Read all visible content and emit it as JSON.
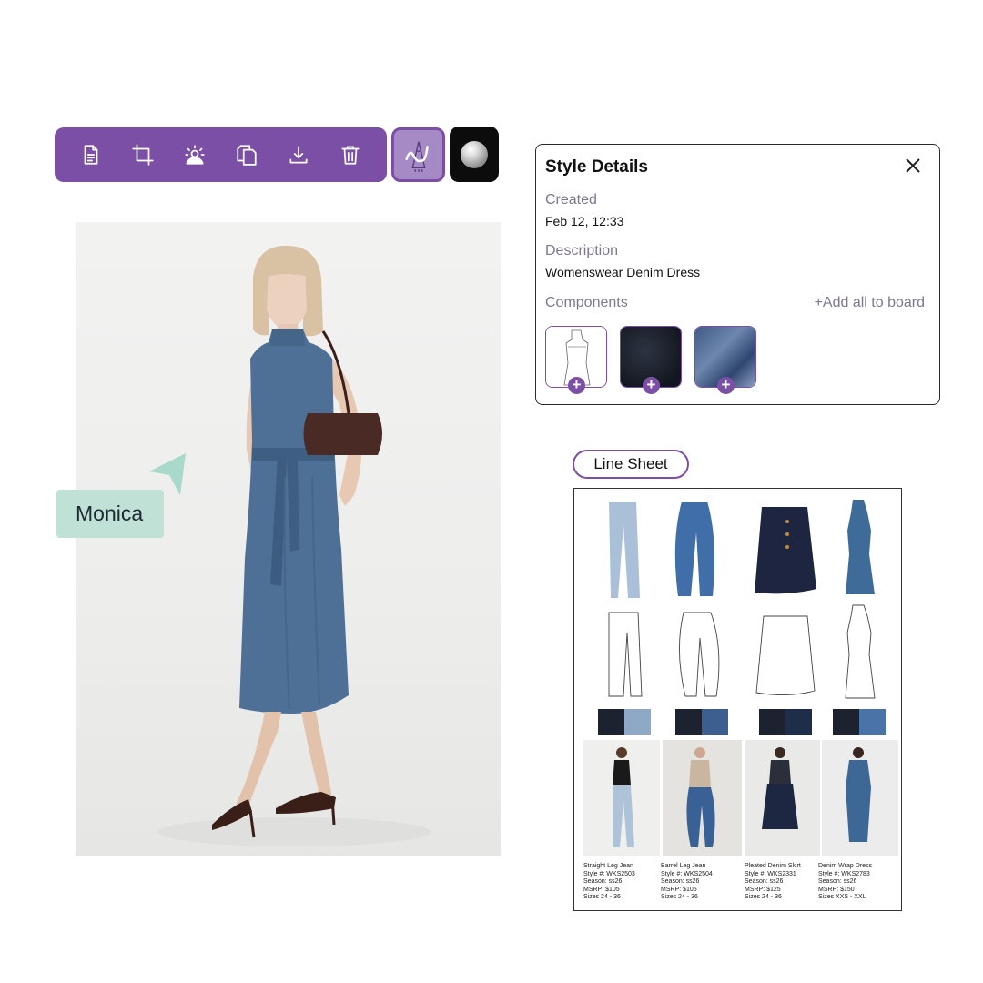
{
  "toolbar": {
    "tools": [
      "document-icon",
      "crop-icon",
      "relight-icon",
      "duplicate-icon",
      "download-icon",
      "trash-icon"
    ],
    "draw_tool": "pen-icon",
    "color_swatch": "#c0c0c0",
    "accent": "#7b4fa5"
  },
  "collaborator": {
    "name": "Monica",
    "color": "#bfe1d6"
  },
  "details": {
    "title": "Style Details",
    "created_label": "Created",
    "created_value": "Feb 12, 12:33",
    "description_label": "Description",
    "description_value": "Womenswear Denim Dress",
    "components_label": "Components",
    "add_all": "+Add all to board",
    "components": [
      "flat-sketch",
      "dark-denim-swatch",
      "light-denim-swatch"
    ]
  },
  "line_sheet": {
    "tab_label": "Line Sheet",
    "items": [
      {
        "name": "Straight Leg Jean",
        "style": "Style #: WKS2503",
        "season": "Season: ss26",
        "msrp": "MSRP: $105",
        "sizes": "Sizes 24 - 36"
      },
      {
        "name": "Barrel Leg Jean",
        "style": "Style #: WKS2504",
        "season": "Season: ss26",
        "msrp": "MSRP: $105",
        "sizes": "Sizes 24 - 36"
      },
      {
        "name": "Pleated Denim Skirt",
        "style": "Style #: WKS2331",
        "season": "Season: ss26",
        "msrp": "MSRP: $125",
        "sizes": "Sizes 24 - 36"
      },
      {
        "name": "Denim Wrap Dress",
        "style": "Style #: WKS2783",
        "season": "Season: ss26",
        "msrp": "MSRP: $150",
        "sizes": "Sizes XXS - XXL"
      }
    ]
  }
}
